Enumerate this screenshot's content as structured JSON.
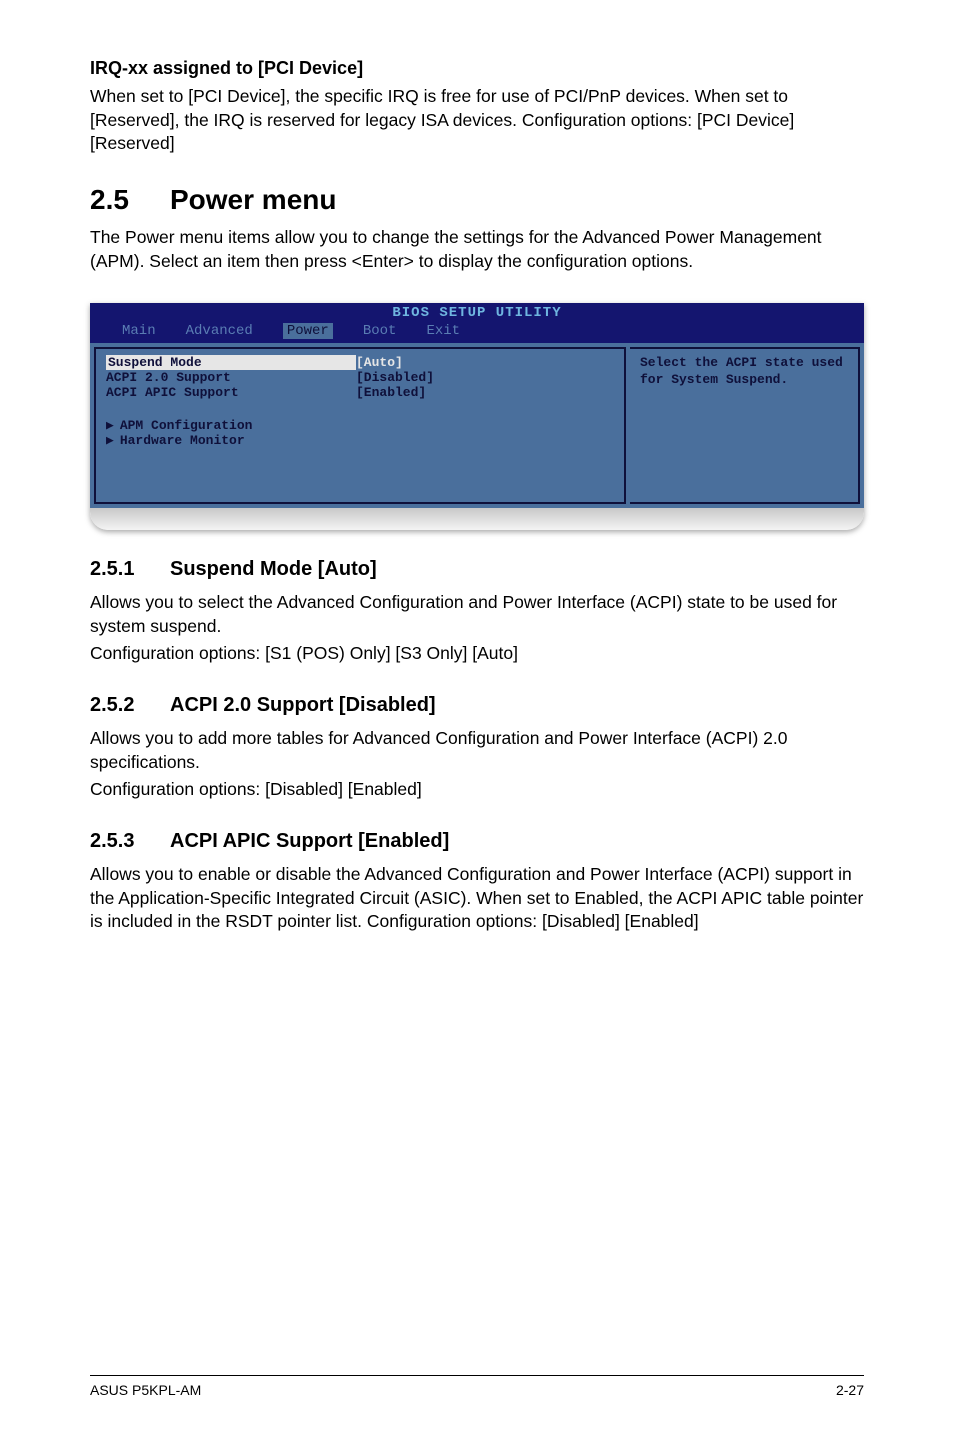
{
  "irq": {
    "title": "IRQ-xx assigned to [PCI Device]",
    "p1": "When set to [PCI Device], the specific IRQ is free for use of PCI/PnP devices. When set to [Reserved], the IRQ is reserved for legacy ISA devices. Configuration options: [PCI Device] [Reserved]"
  },
  "power": {
    "num": "2.5",
    "title": "Power menu",
    "intro": "The Power menu items allow you to change the settings for the Advanced Power Management (APM). Select an item then press <Enter> to display the configuration options."
  },
  "bios": {
    "title": "BIOS SETUP UTILITY",
    "tabs": {
      "main": "Main",
      "advanced": "Advanced",
      "power": "Power",
      "boot": "Boot",
      "exit": "Exit"
    },
    "rows": {
      "suspend": {
        "label": "Suspend Mode",
        "val": "[Auto]"
      },
      "acpi20": {
        "label": "ACPI 2.0 Support",
        "val": "[Disabled]"
      },
      "apic": {
        "label": "ACPI APIC Support",
        "val": "[Enabled]"
      }
    },
    "subs": {
      "apm": "APM Configuration",
      "hw": "Hardware Monitor"
    },
    "help": "Select the ACPI state used for System Suspend."
  },
  "s251": {
    "num": "2.5.1",
    "title": "Suspend Mode [Auto]",
    "p": "Allows you to select the Advanced Configuration and Power Interface (ACPI) state to be used for system suspend.",
    "opts": "Configuration options: [S1 (POS) Only] [S3 Only] [Auto]"
  },
  "s252": {
    "num": "2.5.2",
    "title": "ACPI 2.0 Support [Disabled]",
    "p": "Allows you to add more tables for Advanced Configuration and Power Interface (ACPI) 2.0 specifications.",
    "opts": "Configuration options: [Disabled] [Enabled]"
  },
  "s253": {
    "num": "2.5.3",
    "title": "ACPI APIC Support [Enabled]",
    "p": "Allows you to enable or disable the Advanced Configuration and Power Interface (ACPI) support in the Application-Specific Integrated Circuit (ASIC). When set to Enabled, the ACPI APIC table pointer is included in the RSDT pointer list. Configuration options: [Disabled] [Enabled]"
  },
  "footer": {
    "left": "ASUS P5KPL-AM",
    "right": "2-27"
  }
}
